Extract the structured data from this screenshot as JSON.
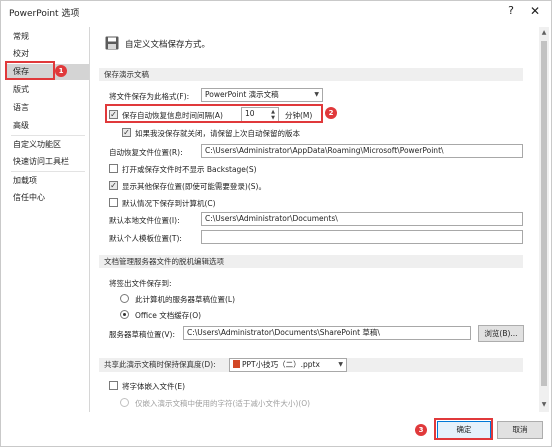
{
  "window": {
    "title": "PowerPoint 选项",
    "help": "?",
    "close": "✕"
  },
  "nav": {
    "items": [
      "常规",
      "校对",
      "保存",
      "版式",
      "语言",
      "高级",
      "自定义功能区",
      "快速访问工具栏",
      "加载项",
      "信任中心"
    ],
    "selected": "保存"
  },
  "header": {
    "icon": "save-icon",
    "text": "自定义文档保存方式。"
  },
  "save_section": {
    "title": "保存演示文稿",
    "format_label": "将文件保存为此格式(F):",
    "format_value": "PowerPoint 演示文稿",
    "autorecover_label": "保存自动恢复信息时间间隔(A)",
    "autorecover_value": "10",
    "minutes_label": "分钟(M)",
    "keep_last_label": "如果我没保存就关闭，请保留上次自动保留的版本",
    "autorecover_path_label": "自动恢复文件位置(R):",
    "autorecover_path_value": "C:\\Users\\Administrator\\AppData\\Roaming\\Microsoft\\PowerPoint\\",
    "no_backstage_label": "打开或保存文件时不显示 Backstage(S)",
    "show_more_label": "显示其他保存位置(即使可能需要登录)(S)。",
    "default_local_label": "默认情况下保存到计算机(C)",
    "default_local_path_label": "默认本地文件位置(I):",
    "default_local_path_value": "C:\\Users\\Administrator\\Documents\\",
    "personal_templates_label": "默认个人模板位置(T):",
    "personal_templates_value": ""
  },
  "offline_section": {
    "title": "文档管理服务器文件的脱机编辑选项",
    "save_to_label": "将签出文件保存到:",
    "radio_server": "此计算机的服务器草稿位置(L)",
    "radio_office": "Office 文档缓存(O)",
    "drafts_label": "服务器草稿位置(V):",
    "drafts_value": "C:\\Users\\Administrator\\Documents\\SharePoint 草稿\\",
    "browse": "浏览(B)..."
  },
  "fidelity_section": {
    "label": "共享此演示文稿时保持保真度(D):",
    "file_value": "PPT小技巧（二）.pptx",
    "embed_fonts_label": "将字体嵌入文件(E)",
    "embed_only_used_label": "仅嵌入演示文稿中使用的字符(适于减小文件大小)(O)"
  },
  "footer": {
    "ok": "确定",
    "cancel": "取消"
  },
  "annotations": {
    "badge1": "1",
    "badge2": "2",
    "badge3": "3"
  },
  "colors": {
    "highlight": "#e0393b",
    "selected_nav": "#d4d4d4",
    "section_bg": "#efefef"
  }
}
